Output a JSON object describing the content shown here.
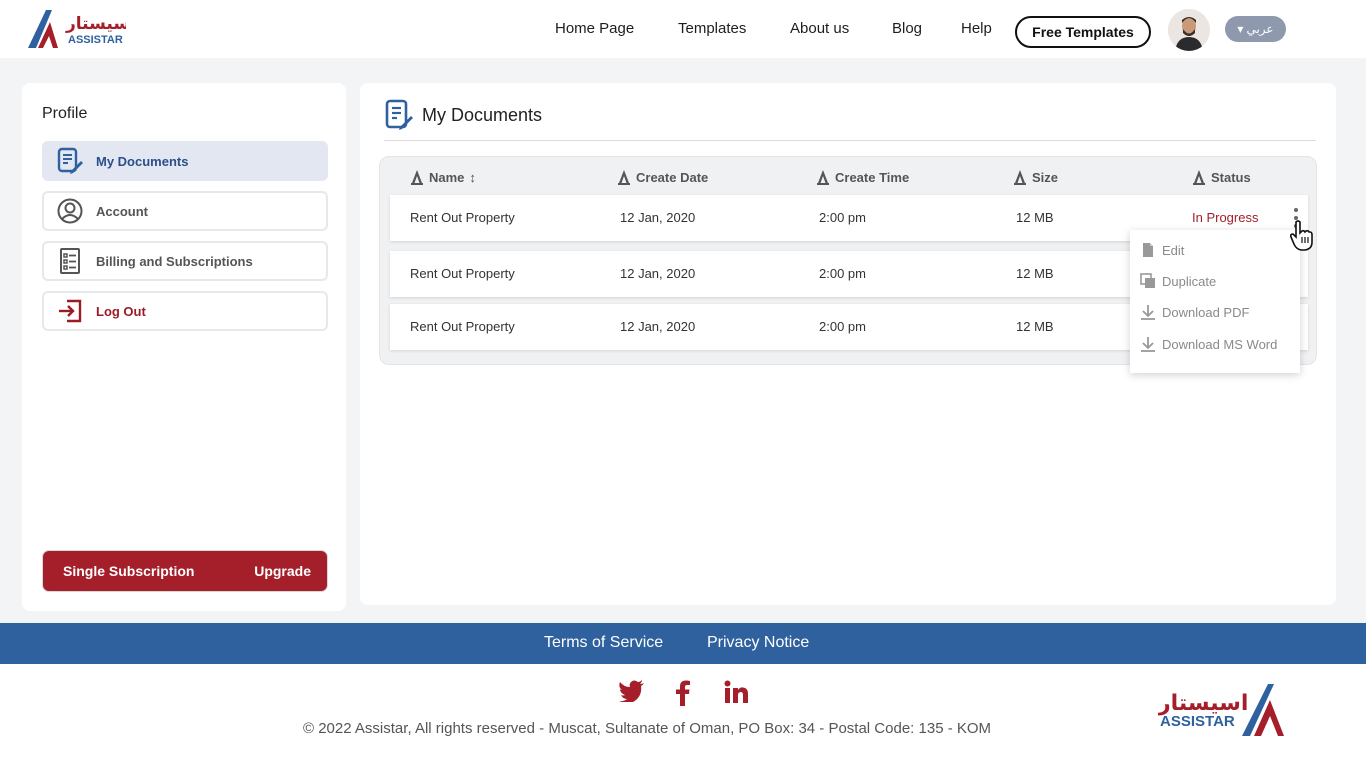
{
  "brand": {
    "name_ar": "اسيستار",
    "name_en": "ASSISTAR",
    "primary_color": "#a41f29",
    "secondary_color": "#2e619e"
  },
  "header": {
    "nav": [
      "Home Page",
      "Templates",
      "About us",
      "Blog",
      "Help"
    ],
    "free_templates": "Free Templates",
    "language": "عربي"
  },
  "sidebar": {
    "title": "Profile",
    "items": [
      {
        "label": "My Documents",
        "icon": "document-edit-icon",
        "active": true
      },
      {
        "label": "Account",
        "icon": "user-circle-icon"
      },
      {
        "label": "Billing and Subscriptions",
        "icon": "checklist-icon"
      },
      {
        "label": "Log Out",
        "icon": "logout-icon"
      }
    ],
    "subscription": {
      "plan": "Single Subscription",
      "action": "Upgrade"
    }
  },
  "main": {
    "title": "My Documents",
    "columns": [
      "Name",
      "Create Date",
      "Create Time",
      "Size",
      "Status"
    ],
    "rows": [
      {
        "name": "Rent Out Property",
        "date": "12 Jan, 2020",
        "time": "2:00 pm",
        "size": "12 MB",
        "status": "In Progress"
      },
      {
        "name": "Rent Out Property",
        "date": "12 Jan, 2020",
        "time": "2:00 pm",
        "size": "12 MB",
        "status": ""
      },
      {
        "name": "Rent Out Property",
        "date": "12 Jan, 2020",
        "time": "2:00 pm",
        "size": "12 MB",
        "status": ""
      }
    ],
    "menu": [
      {
        "label": "Edit",
        "icon": "edit-file-icon"
      },
      {
        "label": "Duplicate",
        "icon": "duplicate-icon"
      },
      {
        "label": "Download PDF",
        "icon": "download-icon"
      },
      {
        "label": "Download MS Word",
        "icon": "download-icon"
      }
    ]
  },
  "footer": {
    "links": [
      "Terms of Service",
      "Privacy Notice"
    ],
    "copyright": "© 2022 Assistar, All rights reserved - Muscat, Sultanate of Oman, PO Box: 34 - Postal Code: 135 - KOM",
    "social": [
      "twitter-icon",
      "facebook-icon",
      "linkedin-icon"
    ]
  }
}
